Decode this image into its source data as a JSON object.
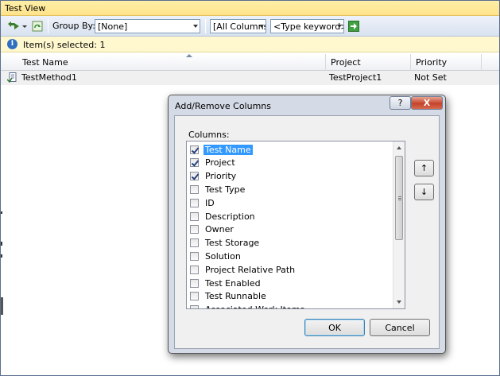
{
  "window": {
    "title": "Test View"
  },
  "toolbar": {
    "group_by_label": "Group By:",
    "group_by_value": "[None]",
    "column_filter_value": "[All Columns]",
    "keyword_value": "<Type keyword>"
  },
  "infobar": {
    "text": "Item(s) selected: 1"
  },
  "grid": {
    "columns": [
      "Test Name",
      "Project",
      "Priority"
    ],
    "rows": [
      {
        "test_name": "TestMethod1",
        "project": "TestProject1",
        "priority": "Not Set"
      }
    ]
  },
  "dialog": {
    "title": "Add/Remove Columns",
    "help_label": "?",
    "close_label": "X",
    "columns_label": "Columns:",
    "items": [
      {
        "label": "Test Name",
        "checked": true,
        "selected": true
      },
      {
        "label": "Project",
        "checked": true,
        "selected": false
      },
      {
        "label": "Priority",
        "checked": true,
        "selected": false
      },
      {
        "label": "Test Type",
        "checked": false,
        "selected": false
      },
      {
        "label": "ID",
        "checked": false,
        "selected": false
      },
      {
        "label": "Description",
        "checked": false,
        "selected": false
      },
      {
        "label": "Owner",
        "checked": false,
        "selected": false
      },
      {
        "label": "Test Storage",
        "checked": false,
        "selected": false
      },
      {
        "label": "Solution",
        "checked": false,
        "selected": false
      },
      {
        "label": "Project Relative Path",
        "checked": false,
        "selected": false
      },
      {
        "label": "Test Enabled",
        "checked": false,
        "selected": false
      },
      {
        "label": "Test Runnable",
        "checked": false,
        "selected": false
      },
      {
        "label": "Associated Work Items",
        "checked": false,
        "selected": false
      }
    ],
    "ok_label": "OK",
    "cancel_label": "Cancel",
    "move_up_label": "↑",
    "move_down_label": "↓"
  },
  "colors": {
    "title_bar": "#ffe38a",
    "toolbar": "#d9e2f0",
    "info_bar": "#fff8cf",
    "selection": "#3399ff",
    "dialog_frame": "#d5dbe6",
    "close_button": "#c4432a"
  }
}
